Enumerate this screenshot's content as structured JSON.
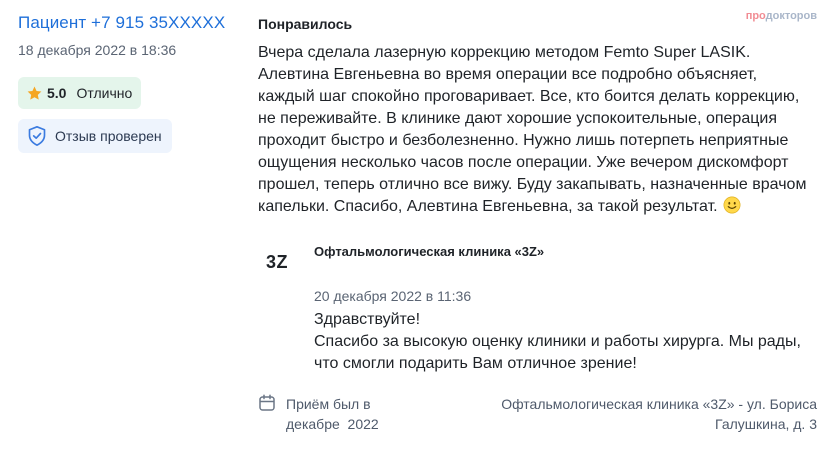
{
  "review": {
    "author": "Пациент +7 915 35XXXXX",
    "date": "18 декабря 2022 в 18:36",
    "rating_value": "5.0",
    "rating_label": "Отлично",
    "verified_label": "Отзыв проверен",
    "section_label": "Понравилось",
    "text": "Вчера сделала лазерную коррекцию методом Femto Super LASIK. Алевтина Евгеньевна во время операции все подробно объясняет, каждый шаг спокойно проговаривает. Все, кто боится делать коррекцию, не переживайте. В клинике дают хорошие успокоительные, операция проходит быстро и безболезненно. Нужно лишь потерпеть неприятные ощущения несколько часов после операции. Уже вечером дискомфорт прошел, теперь отлично все вижу. Буду закапывать, назначенные врачом капельки. Спасибо, Алевтина Евгеньевна, за такой результат.",
    "emoji_icon": "smiley-emoji-icon"
  },
  "brand": {
    "part1": "про",
    "part2": "докторов"
  },
  "reply": {
    "logo_text": "3Z",
    "clinic_name": "Офтальмологическая клиника «3Z»",
    "date": "20 декабря 2022 в 11:36",
    "greeting": "Здравствуйте!",
    "text": "Спасибо за высокую оценку клиники и работы хирурга. Мы рады, что смогли подарить Вам отличное зрение!"
  },
  "footer": {
    "visit_line1": "Приём был в",
    "visit_line2": "декабре  2022",
    "address_line1": "Офтальмологическая клиника «3Z» - ул. Бориса",
    "address_line2": "Галушкина, д. 3"
  },
  "colors": {
    "link_blue": "#1e6fd9",
    "rating_bg": "#e4f5eb",
    "verified_bg": "#eef4fd",
    "star": "#f5a623",
    "shield": "#3b7be0"
  }
}
